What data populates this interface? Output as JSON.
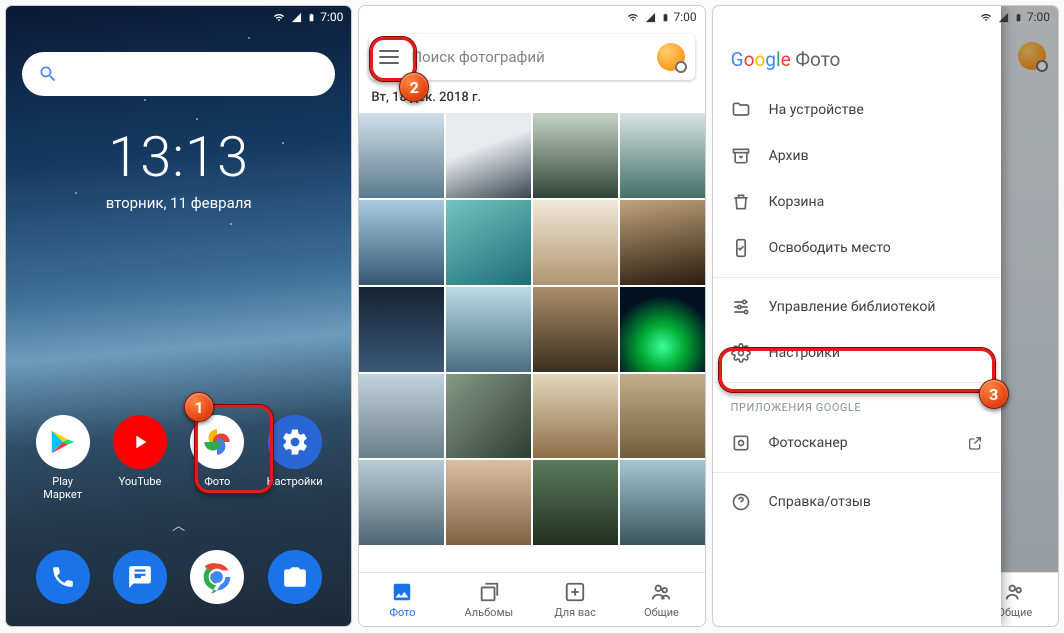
{
  "status": {
    "time": "7:00"
  },
  "home": {
    "clock": "13:13",
    "date": "вторник, 11 февраля",
    "apps": [
      {
        "label": "Play Маркет"
      },
      {
        "label": "YouTube"
      },
      {
        "label": "Фото"
      },
      {
        "label": "Настройки"
      }
    ]
  },
  "photos": {
    "search_placeholder": "Поиск фотографий",
    "date_header": "Вт, 18 дек. 2018 г.",
    "nav": {
      "photo": "Фото",
      "albums": "Альбомы",
      "foryou": "Для вас",
      "shared": "Общие"
    }
  },
  "drawer": {
    "brand_product": "Фото",
    "items": {
      "device": "На устройстве",
      "archive": "Архив",
      "trash": "Корзина",
      "free": "Освободить место",
      "library": "Управление библиотекой",
      "settings": "Настройки"
    },
    "section": "ПРИЛОЖЕНИЯ GOOGLE",
    "scanner": "Фотосканер",
    "help": "Справка/отзыв"
  },
  "badges": {
    "one": "1",
    "two": "2",
    "three": "3"
  }
}
